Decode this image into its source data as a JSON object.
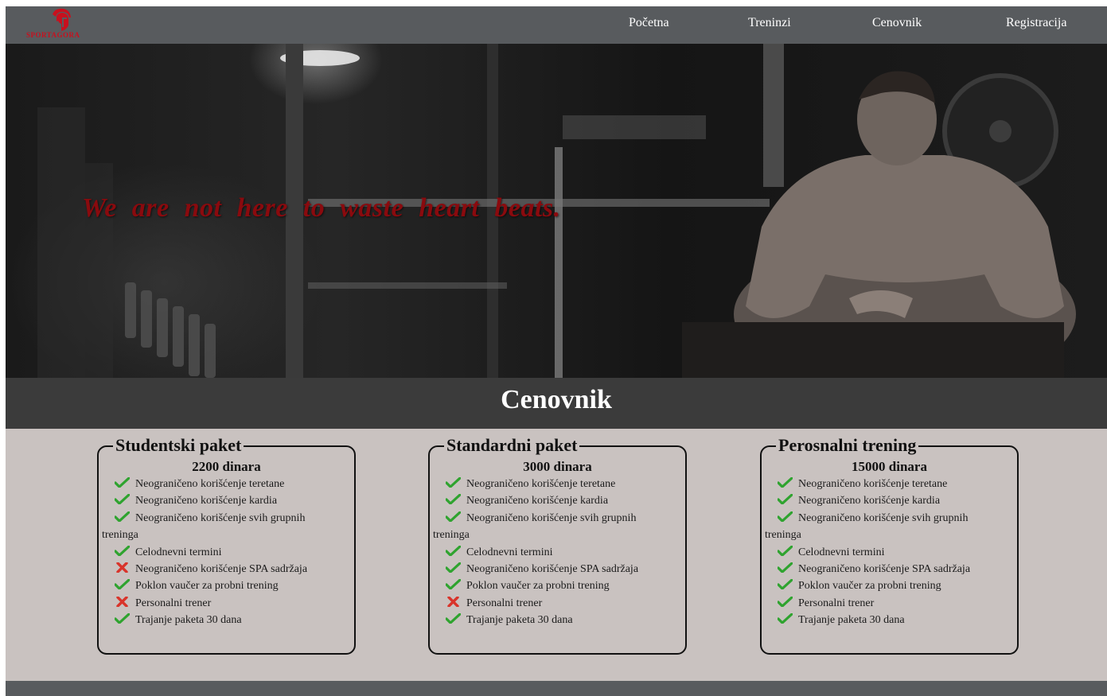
{
  "brand": {
    "logo_text": "SPORTAGORA"
  },
  "nav": {
    "items": [
      {
        "label": "Početna"
      },
      {
        "label": "Treninzi"
      },
      {
        "label": "Cenovnik"
      },
      {
        "label": "Registracija"
      }
    ]
  },
  "hero": {
    "tagline": "We are not here to waste heart beats."
  },
  "pricing": {
    "title": "Cenovnik",
    "packages": [
      {
        "name": "Studentski paket",
        "price": "2200 dinara",
        "features": [
          {
            "text": "Neograničeno korišćenje teretane",
            "included": true
          },
          {
            "text": "Neograničeno korišćenje kardia",
            "included": true
          },
          {
            "text": "Neograničeno korišćenje svih grupnih treninga",
            "included": true
          },
          {
            "text": "Celodnevni termini",
            "included": true
          },
          {
            "text": "Neograničeno korišćenje SPA sadržaja",
            "included": false
          },
          {
            "text": "Poklon vaučer za probni trening",
            "included": true
          },
          {
            "text": "Personalni trener",
            "included": false
          },
          {
            "text": "Trajanje paketa 30 dana",
            "included": true
          }
        ]
      },
      {
        "name": "Standardni paket",
        "price": "3000 dinara",
        "features": [
          {
            "text": "Neograničeno korišćenje teretane",
            "included": true
          },
          {
            "text": "Neograničeno korišćenje kardia",
            "included": true
          },
          {
            "text": "Neograničeno korišćenje svih grupnih treninga",
            "included": true
          },
          {
            "text": "Celodnevni termini",
            "included": true
          },
          {
            "text": "Neograničeno korišćenje SPA sadržaja",
            "included": true
          },
          {
            "text": "Poklon vaučer za probni trening",
            "included": true
          },
          {
            "text": "Personalni trener",
            "included": false
          },
          {
            "text": "Trajanje paketa 30 dana",
            "included": true
          }
        ]
      },
      {
        "name": "Perosnalni trening",
        "price": "15000 dinara",
        "features": [
          {
            "text": "Neograničeno korišćenje teretane",
            "included": true
          },
          {
            "text": "Neograničeno korišćenje kardia",
            "included": true
          },
          {
            "text": "Neograničeno korišćenje svih grupnih treninga",
            "included": true
          },
          {
            "text": "Celodnevni termini",
            "included": true
          },
          {
            "text": "Neograničeno korišćenje SPA sadržaja",
            "included": true
          },
          {
            "text": "Poklon vaučer za probni trening",
            "included": true
          },
          {
            "text": "Personalni trener",
            "included": true
          },
          {
            "text": "Trajanje paketa 30 dana",
            "included": true
          }
        ]
      }
    ]
  },
  "icons": {
    "included": "check-icon",
    "excluded": "cross-icon",
    "logo": "spartan-helmet-icon"
  },
  "colors": {
    "nav": "#585b5e",
    "title_band": "#3b3b3b",
    "content_bg": "#c9c2c0",
    "accent_red": "#c8101e",
    "check": "#2fa32f",
    "cross": "#d9342b"
  }
}
